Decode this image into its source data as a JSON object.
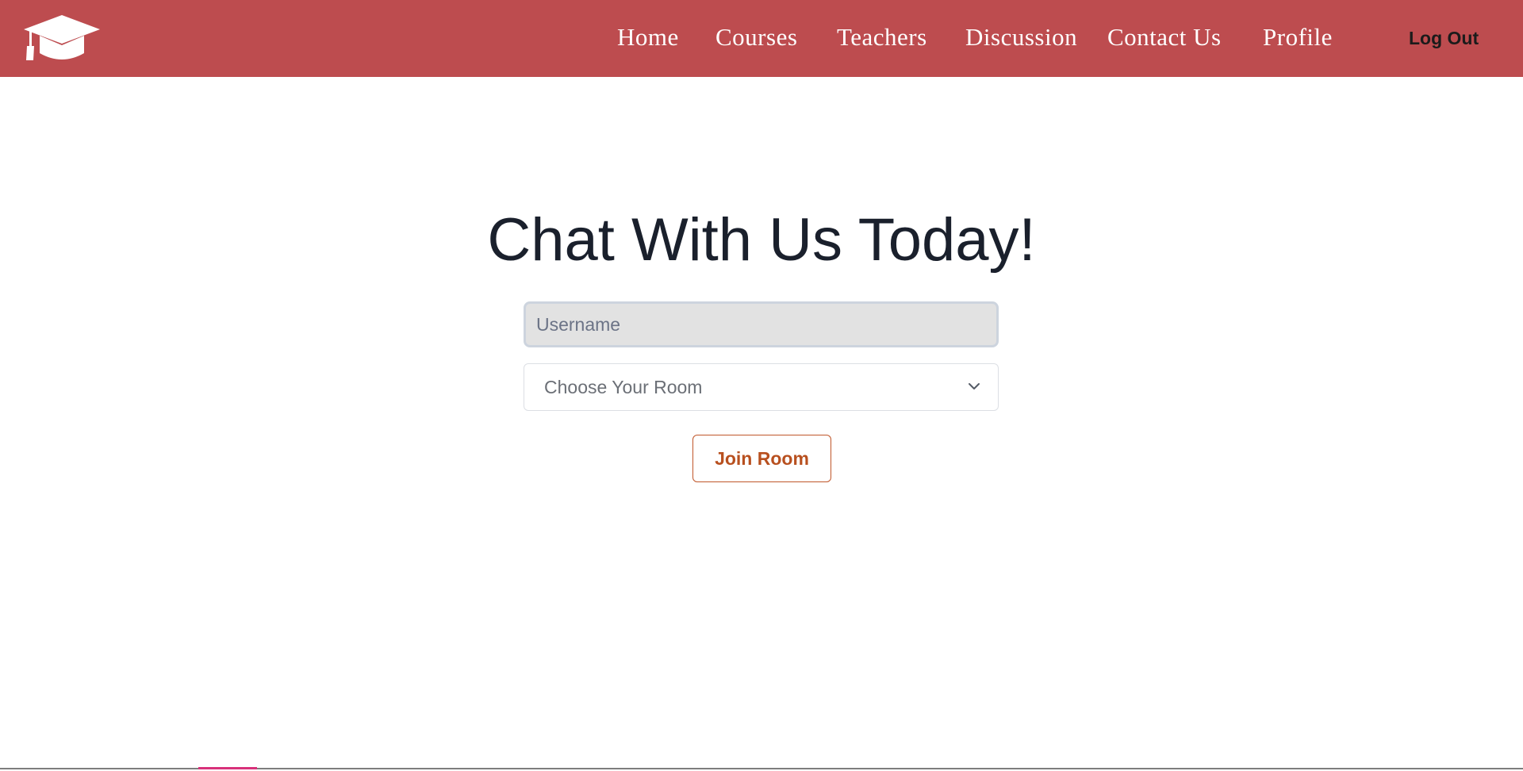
{
  "navbar": {
    "logo_icon": "graduation-cap-icon",
    "background_color": "#bd4c4f",
    "links": [
      {
        "label": "Home"
      },
      {
        "label": "Courses"
      },
      {
        "label": "Teachers"
      },
      {
        "label": "Discussion"
      },
      {
        "label": "Contact Us"
      },
      {
        "label": "Profile"
      }
    ],
    "logout_label": "Log Out"
  },
  "main": {
    "title": "Chat With Us Today!",
    "username": {
      "placeholder": "Username",
      "value": ""
    },
    "room_select": {
      "selected": "Choose Your Room",
      "icon": "chevron-down-icon"
    },
    "join_button_label": "Join Room",
    "accent_color": "#b8501f"
  }
}
